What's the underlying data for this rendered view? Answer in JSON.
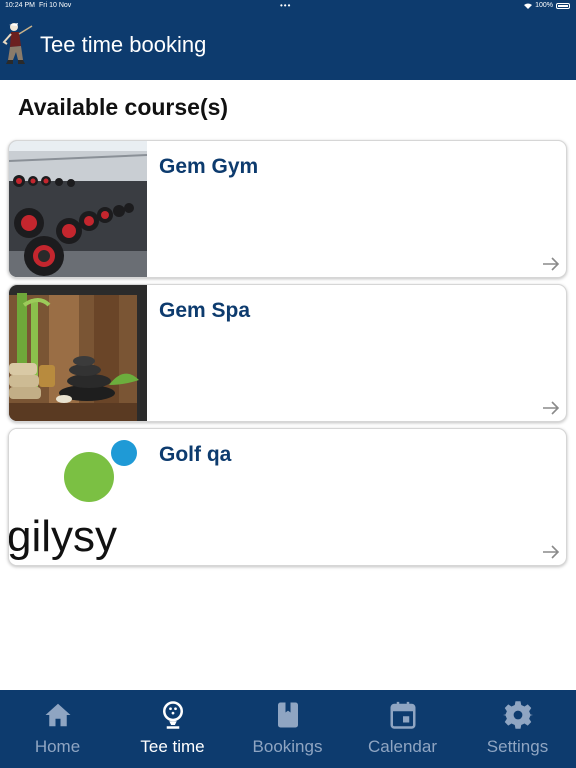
{
  "status_bar": {
    "time": "10:24 PM",
    "date": "Fri 10 Nov",
    "dots": "•••",
    "battery": "100%"
  },
  "header": {
    "title": "Tee time booking"
  },
  "section": {
    "title": "Available course(s)"
  },
  "courses": [
    {
      "name": "Gem Gym",
      "image": "gym-dumbbells-photo"
    },
    {
      "name": "Gem Spa",
      "image": "spa-stones-photo"
    },
    {
      "name": "Golf qa",
      "image": "gilysys-logo",
      "logo_text": "gilysy"
    }
  ],
  "tabs": [
    {
      "label": "Home",
      "icon": "home-icon",
      "active": false
    },
    {
      "label": "Tee time",
      "icon": "golf-ball-icon",
      "active": true
    },
    {
      "label": "Bookings",
      "icon": "book-icon",
      "active": false
    },
    {
      "label": "Calendar",
      "icon": "calendar-icon",
      "active": false
    },
    {
      "label": "Settings",
      "icon": "gear-icon",
      "active": false
    }
  ],
  "colors": {
    "primary": "#0d3b6e",
    "inactive_tab": "#8fa5c2",
    "logo_green": "#7bc043",
    "logo_blue": "#1f9ad6"
  }
}
